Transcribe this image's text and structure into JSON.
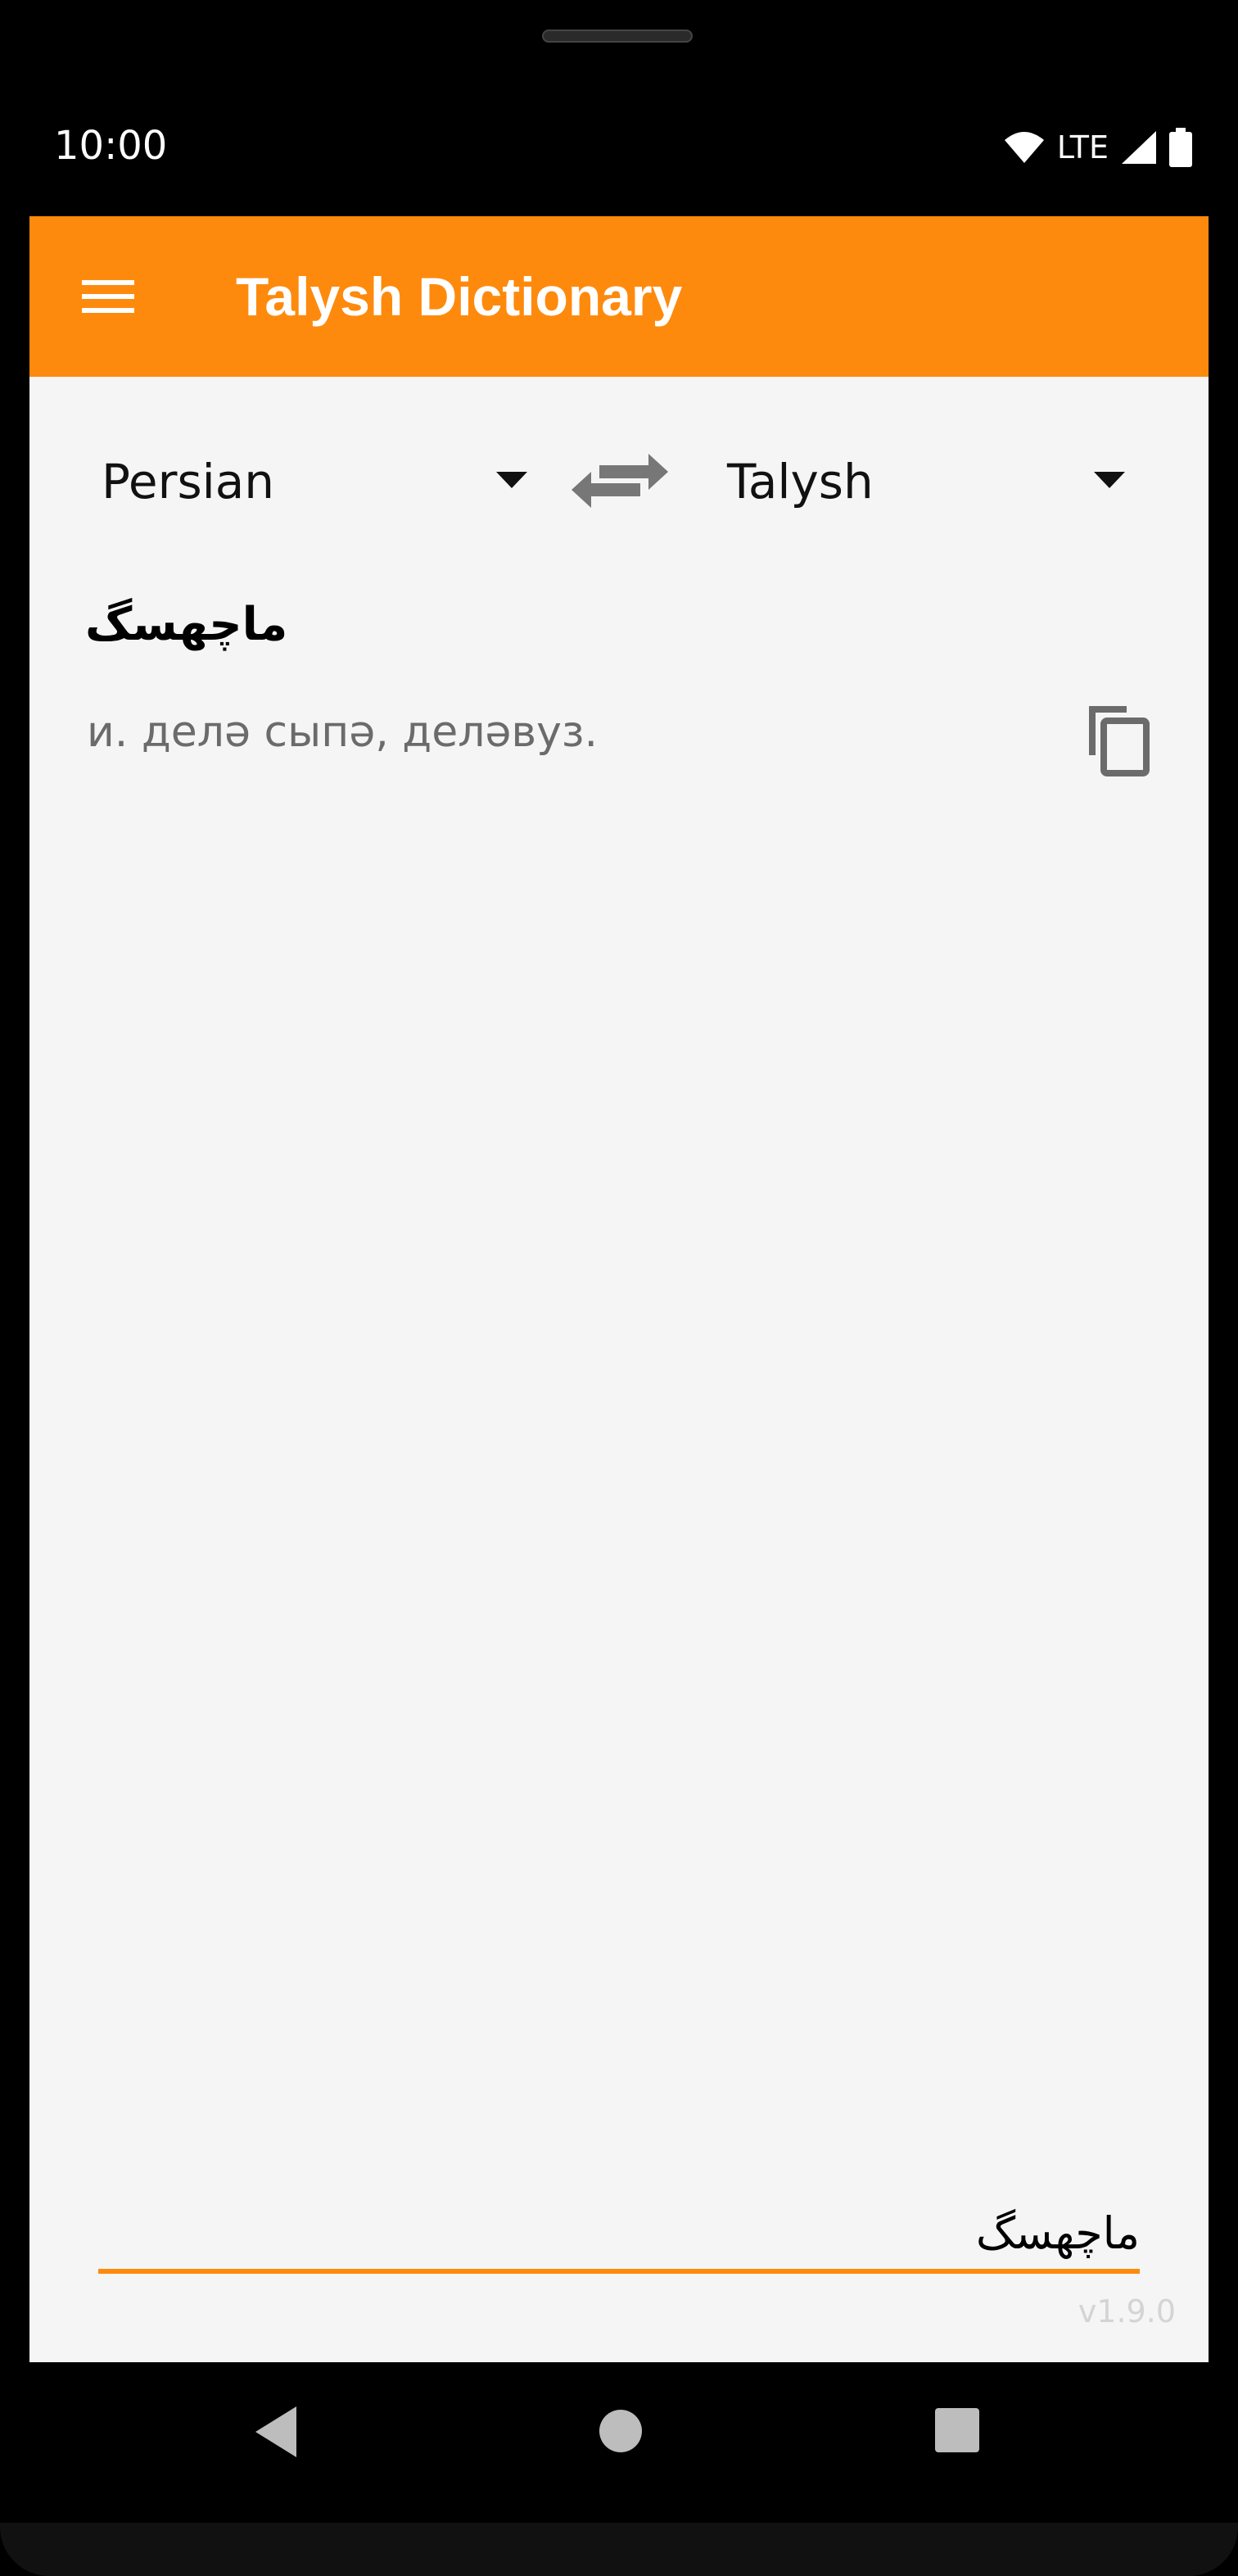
{
  "status_bar": {
    "time": "10:00",
    "network": "LTE",
    "icons": [
      "wifi-icon",
      "signal-icon",
      "battery-icon"
    ]
  },
  "app_bar": {
    "title": "Talysh Dictionary",
    "menu_icon": "hamburger-menu-icon",
    "color": "#fe8a0d"
  },
  "language_selector": {
    "from_language": "Persian",
    "to_language": "Talysh",
    "swap_icon": "swap-arrows-icon"
  },
  "result": {
    "word": "ماچهسگ",
    "translation": "и. делә сыпә, деләвуз.",
    "copy_icon": "copy-icon"
  },
  "search": {
    "value": "ماچهسگ",
    "underline_color": "#fe8a0d"
  },
  "footer": {
    "version": "v1.9.0"
  },
  "nav_bar": {
    "icons": [
      "back-icon",
      "home-icon",
      "recents-icon"
    ]
  }
}
